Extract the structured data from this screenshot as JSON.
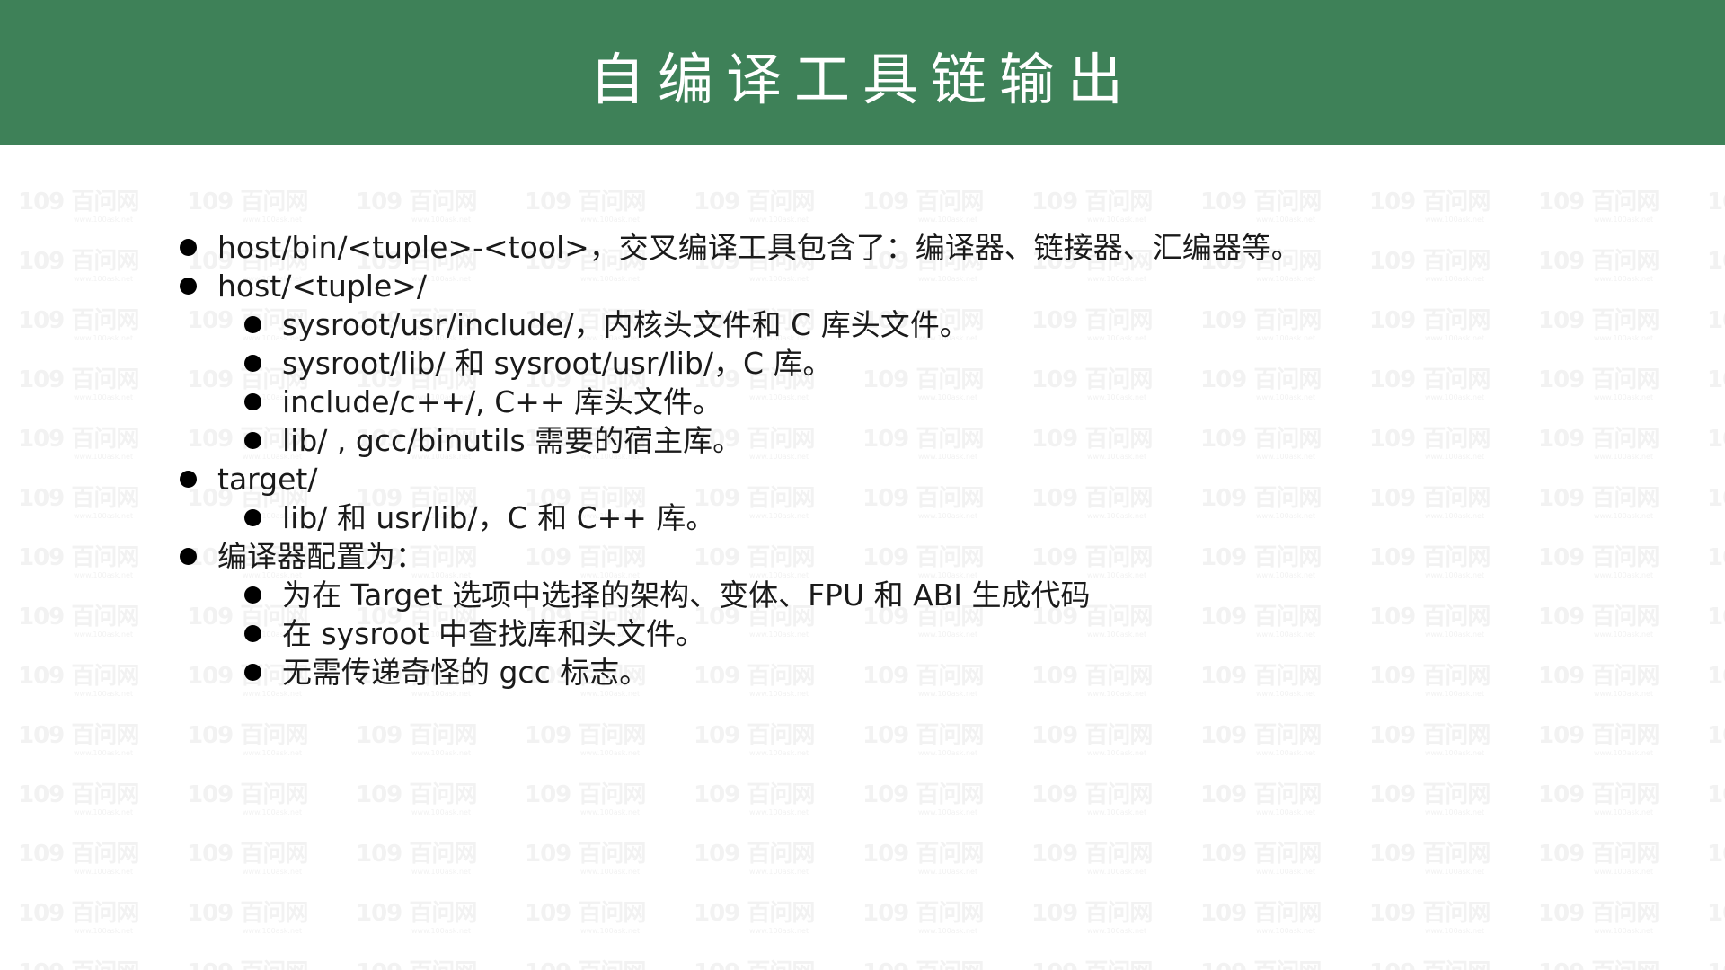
{
  "slide": {
    "title": "自编译工具链输出",
    "header_color": "#3e8158",
    "watermark": {
      "logo": "109 百问网",
      "url": "www.100ask.net"
    },
    "bullets": [
      {
        "text": "host/bin/<tuple>-<tool>，交叉编译工具包含了：编译器、链接器、汇编器等。",
        "children": []
      },
      {
        "text": "host/<tuple>/",
        "children": [
          "sysroot/usr/include/，内核头文件和 C 库头文件。",
          "sysroot/lib/ 和 sysroot/usr/lib/，C 库。",
          "include/c++/, C++ 库头文件。",
          "lib/ , gcc/binutils 需要的宿主库。"
        ]
      },
      {
        "text": "target/",
        "children": [
          "lib/ 和 usr/lib/，C 和 C++ 库。"
        ]
      },
      {
        "text": "编译器配置为：",
        "children": [
          "为在 Target 选项中选择的架构、变体、FPU 和 ABI 生成代码",
          "在 sysroot 中查找库和头文件。",
          "无需传递奇怪的 gcc 标志。"
        ]
      }
    ]
  }
}
